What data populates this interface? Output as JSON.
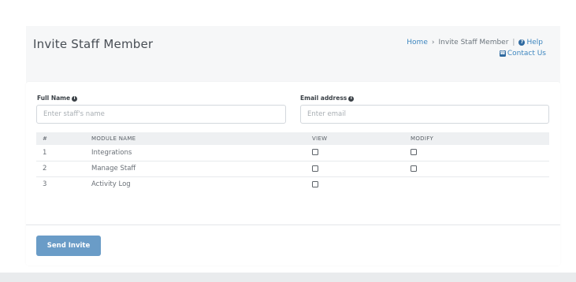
{
  "header": {
    "title": "Invite Staff Member",
    "breadcrumb": {
      "home": "Home",
      "separator": "›",
      "current": "Invite Staff Member",
      "divider": "|",
      "help": "Help",
      "contact": "Contact Us"
    }
  },
  "form": {
    "full_name": {
      "label": "Full Name",
      "placeholder": "Enter staff's name",
      "value": ""
    },
    "email": {
      "label": "Email address",
      "placeholder": "Enter email",
      "value": ""
    }
  },
  "table": {
    "headers": {
      "num": "#",
      "module": "MODULE NAME",
      "view": "VIEW",
      "modify": "MODIFY"
    },
    "rows": [
      {
        "num": "1",
        "module": "Integrations",
        "view": false,
        "modify": false
      },
      {
        "num": "2",
        "module": "Manage Staff",
        "view": false,
        "modify": false
      },
      {
        "num": "3",
        "module": "Activity Log",
        "view": false
      }
    ]
  },
  "actions": {
    "send_label": "Send Invite"
  },
  "colors": {
    "accent": "#3d86bf",
    "button": "#6a9cc7",
    "header_bg": "#f6f7f8"
  },
  "icons": {
    "help": "question-circle-icon",
    "contact": "phone-square-icon",
    "info": "info-circle-icon"
  }
}
